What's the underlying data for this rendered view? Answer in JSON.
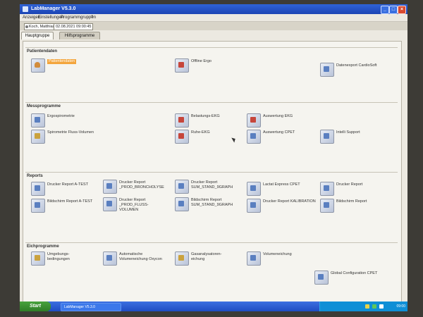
{
  "window": {
    "title": "LabManager V5.3.0"
  },
  "menu": [
    "Anzeigen",
    "Einstellungen",
    "Programmgruppen",
    "?"
  ],
  "user": {
    "name": "Koch, Matthias",
    "timestamp": "02.08.2021 09:00:45"
  },
  "tabs": [
    "Hauptgruppe",
    "Hilfsprogramme"
  ],
  "sections": {
    "patientendaten": {
      "title": "Patientendaten",
      "items": [
        "Patientendaten",
        "Offline Ergo",
        "Datenexport CardioSoft"
      ]
    },
    "messprogramme": {
      "title": "Messprogramme",
      "items": [
        "Ergospirometrie",
        "Spirometrie Fluss-Volumen",
        "Belastungs-EKG",
        "Ruhe-EKG",
        "Auswertung EKG",
        "Auswertung CPET",
        "Intelli Support"
      ]
    },
    "reports": {
      "title": "Reports",
      "items": [
        "Drucker Report A-TEST",
        "Bildschirm Report A-TEST",
        "Drucker Report _PROD_BRONCHOLYSE",
        "Drucker Report _PROD_FLUSS-VOLUMEN",
        "Drucker Report SUM_STAND_9GRAPH",
        "Bildschirm Report SUM_STAND_9GRAPH",
        "Lactat Express CPET",
        "Drucker Report KALIBRATION",
        "Drucker Report",
        "Bildschirm Report"
      ]
    },
    "eichprogramme": {
      "title": "Eichprogramme",
      "items": [
        "Umgebungs-bedingungen",
        "Automatische Volumeneichung Oxycon",
        "Gasanalysatoren-eichung",
        "Volumeneichung",
        "Global Configuration CPET"
      ]
    }
  },
  "taskbar": {
    "start_label": "Start",
    "task": "LabManager V5.3.0",
    "clock": "09:00"
  },
  "colors": {
    "highlight": "#f3a53c",
    "titlebar": "#1c45b4",
    "taskbar": "#1f4cc2",
    "start": "#2f7d27"
  }
}
